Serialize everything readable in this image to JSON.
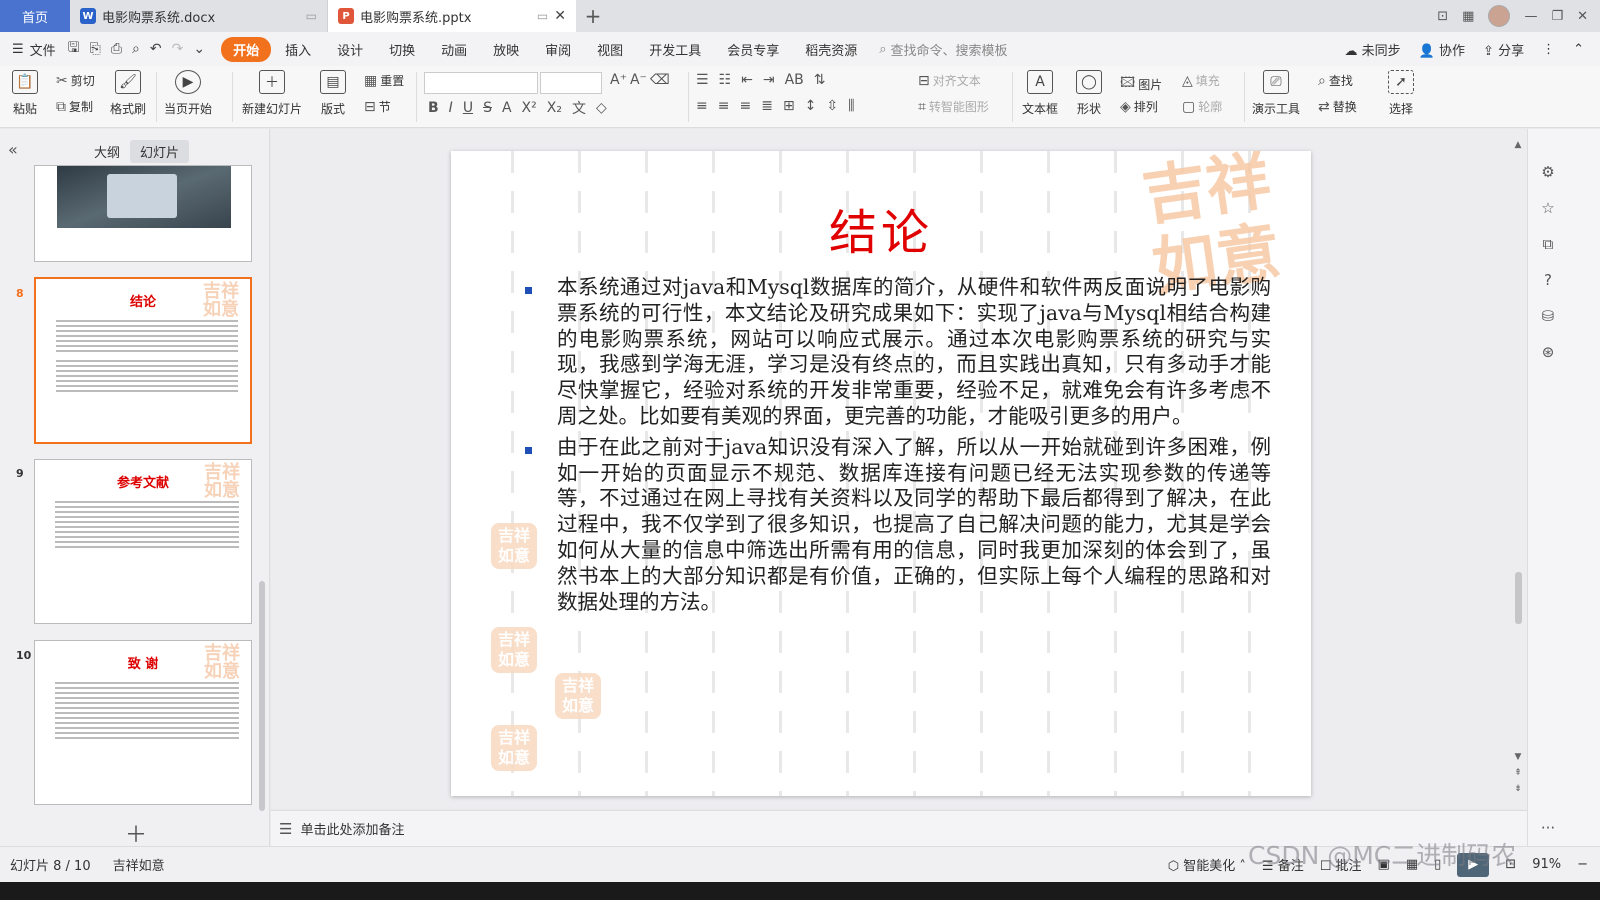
{
  "titlebar": {
    "home": "首页",
    "tabs": [
      {
        "name": "电影购票系统.docx",
        "icon": "word-doc-icon",
        "active": false
      },
      {
        "name": "电影购票系统.pptx",
        "icon": "ppt-doc-icon",
        "active": true
      }
    ],
    "add": "+"
  },
  "menubar": {
    "file": "文件",
    "tabs": [
      "开始",
      "插入",
      "设计",
      "切换",
      "动画",
      "放映",
      "审阅",
      "视图",
      "开发工具",
      "会员专享",
      "稻壳资源"
    ],
    "active_tab": "开始",
    "search": "查找命令、搜索模板",
    "sync": "未同步",
    "collab": "协作",
    "share": "分享"
  },
  "ribbon": {
    "paste": "粘贴",
    "cut": "剪切",
    "copy": "复制",
    "format_painter": "格式刷",
    "from_current": "当页开始",
    "new_slide": "新建幻灯片",
    "layout": "版式",
    "reset": "重置",
    "section": "节",
    "align_text": "对齐文本",
    "smartart": "转智能图形",
    "textbox": "文本框",
    "shape": "形状",
    "picture": "图片",
    "fill": "填充",
    "arrange": "排列",
    "outline": "轮廓",
    "presentation_tools": "演示工具",
    "find": "查找",
    "replace": "替换",
    "select": "选择"
  },
  "leftpanel": {
    "tabs": [
      "大纲",
      "幻灯片"
    ],
    "active_tab": "幻灯片",
    "thumbnails": [
      {
        "num": "8",
        "title": "结论"
      },
      {
        "num": "9",
        "title": "参考文献"
      },
      {
        "num": "10",
        "title": "致  谢"
      }
    ]
  },
  "slide": {
    "title": "结论",
    "stamp": "吉祥如意",
    "bullets": [
      "本系统通过对java和Mysql数据库的简介，从硬件和软件两反面说明了电影购票系统的可行性，本文结论及研究成果如下：实现了java与Mysql相结合构建的电影购票系统，网站可以响应式展示。通过本次电影购票系统的研究与实现，我感到学海无涯，学习是没有终点的，而且实践出真知，只有多动手才能尽快掌握它，经验对系统的开发非常重要，经验不足，就难免会有许多考虑不周之处。比如要有美观的界面，更完善的功能，才能吸引更多的用户。",
      "由于在此之前对于java知识没有深入了解，所以从一开始就碰到许多困难，例如一开始的页面显示不规范、数据库连接有问题已经无法实现参数的传递等等，不过通过在网上寻找有关资料以及同学的帮助下最后都得到了解决，在此过程中，我不仅学到了很多知识，也提高了自己解决问题的能力，尤其是学会如何从大量的信息中筛选出所需有用的信息，同时我更加深刻的体会到了，虽然书本上的大部分知识都是有价值，正确的，但实际上每个人编程的思路和对数据处理的方法。"
    ]
  },
  "notes": {
    "placeholder": "单击此处添加备注"
  },
  "statusbar": {
    "slide_pos": "幻灯片 8 / 10",
    "theme": "吉祥如意",
    "beautify": "智能美化",
    "notes": "备注",
    "comments": "批注",
    "zoom": "91%"
  },
  "watermark": "CSDN @MC二进制码农"
}
